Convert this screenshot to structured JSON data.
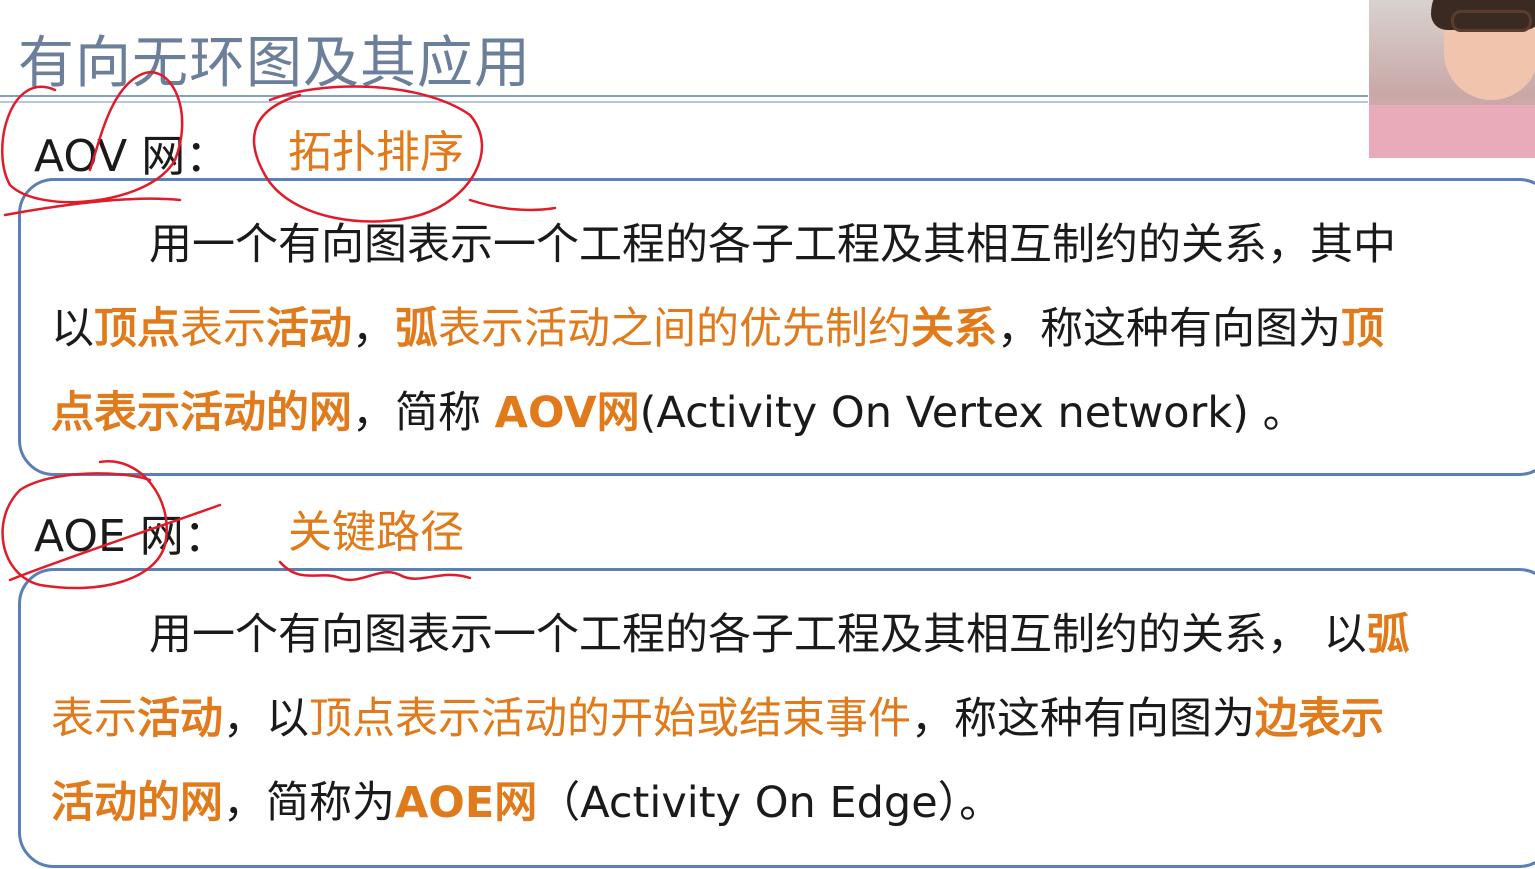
{
  "title": "有向无环图及其应用",
  "aov": {
    "label": "AOV 网：",
    "tag": "拓扑排序",
    "line1": "用一个有向图表示一个工程的各子工程及其相互制约的关系，其中",
    "l2_a": "以",
    "l2_b": "顶点",
    "l2_c": "表示",
    "l2_d": "活动",
    "l2_e": "，",
    "l2_f": "弧",
    "l2_g": "表示活动之间的优先制约",
    "l2_h": "关系",
    "l2_i": "，称这种有向图为",
    "l2_j": "顶",
    "l3_a": "点表示活动的网",
    "l3_b": "，简称 ",
    "l3_c": "AOV网",
    "l3_d": "(Activity On Vertex network) 。"
  },
  "aoe": {
    "label": "AOE 网：",
    "tag": "关键路径",
    "l1_a": "用一个有向图表示一个工程的各子工程及其相互制约的关系， 以",
    "l1_b": "弧",
    "l2_a": "表示",
    "l2_b": "活动",
    "l2_c": "，以",
    "l2_d": "顶点表示活动的开始或结束事件",
    "l2_e": "，称这种有向图为",
    "l2_f": "边表示",
    "l3_a": "活动的网",
    "l3_b": "，简称为",
    "l3_c": "AOE网",
    "l3_d": "（Activity  On  Edge）。"
  },
  "colors": {
    "accent": "#e07a1a",
    "ink": "#e01c2a",
    "frame": "#5b80b4"
  }
}
